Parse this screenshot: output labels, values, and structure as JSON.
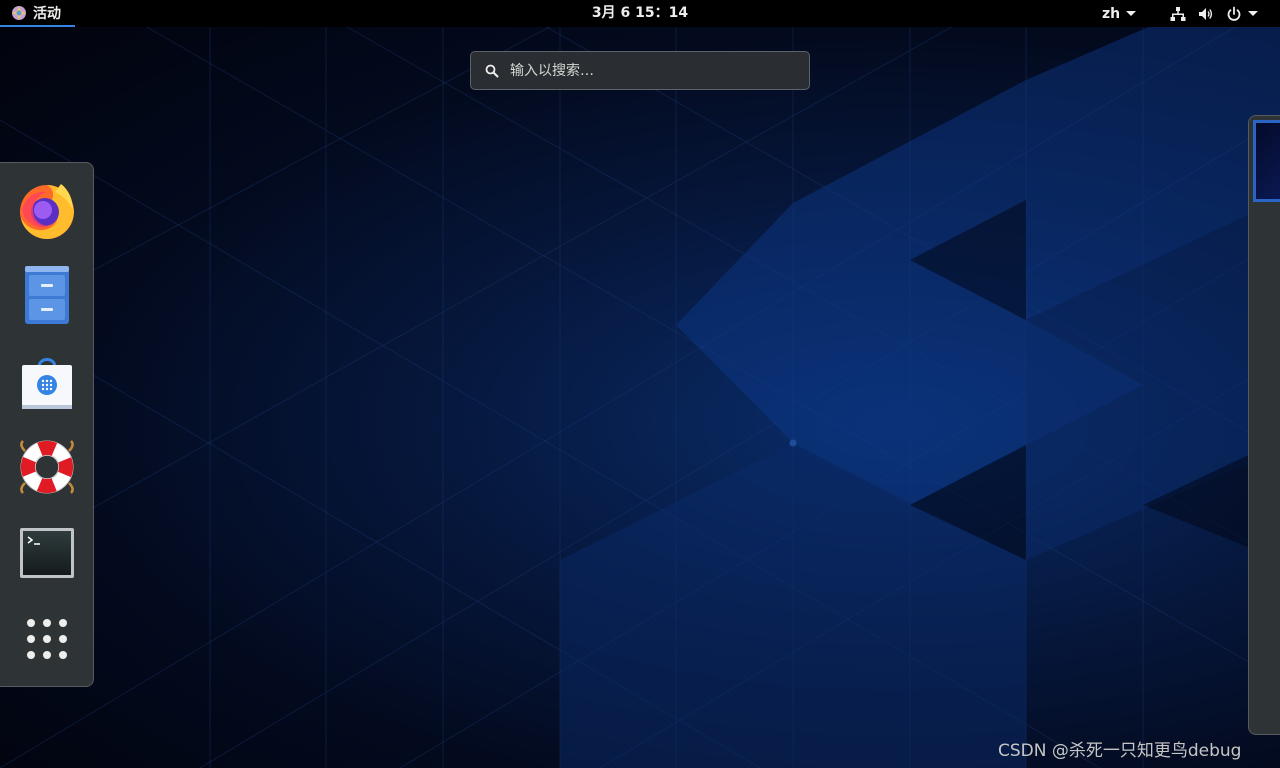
{
  "topbar": {
    "activities_label": "活动",
    "clock": "3月 6  15：14",
    "language": "zh"
  },
  "search": {
    "placeholder": "输入以搜索…"
  },
  "dash": {
    "items": [
      {
        "name": "Firefox",
        "icon": "firefox-icon"
      },
      {
        "name": "Files",
        "icon": "files-cabinet-icon"
      },
      {
        "name": "Software",
        "icon": "software-bag-icon"
      },
      {
        "name": "Help",
        "icon": "lifebuoy-icon"
      },
      {
        "name": "Terminal",
        "icon": "terminal-icon"
      },
      {
        "name": "Show Applications",
        "icon": "app-grid-icon"
      }
    ]
  },
  "watermark": "CSDN @杀死一只知更鸟debug",
  "colors": {
    "topbar": "#000000",
    "activities_underline": "#3584e4",
    "dash_bg": "#2e3436",
    "search_bg": "#2a2e33",
    "workspace_border": "#2a64c5"
  }
}
